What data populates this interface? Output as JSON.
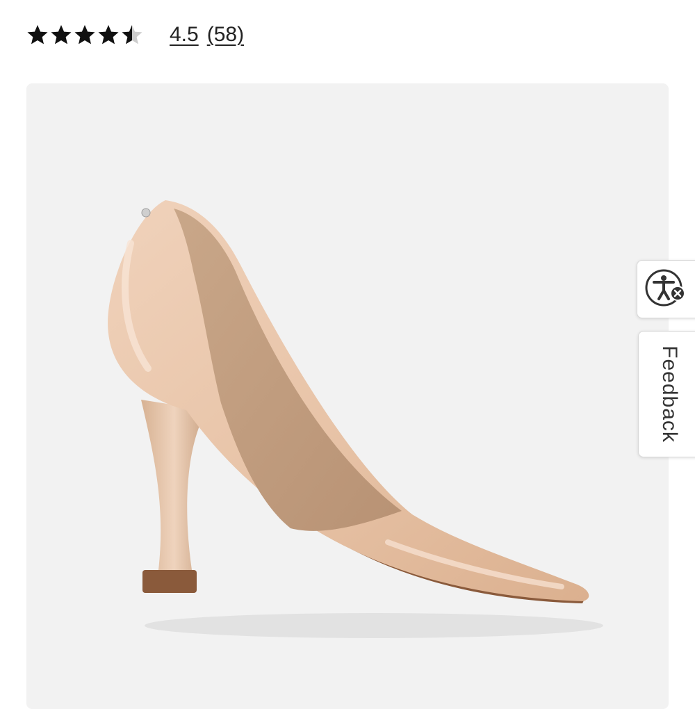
{
  "rating": {
    "value": 4.5,
    "value_label": "4.5",
    "count_label": "(58)",
    "max_stars": 5,
    "star_color": "#111111",
    "empty_star_color": "#cccccc"
  },
  "product_image": {
    "subject": "nude patent leather pointed-toe high-heel pump",
    "background_color": "#f2f2f2",
    "shoe_color": "#e8c4a8"
  },
  "side_tabs": {
    "accessibility_icon": "accessibility-icon",
    "feedback_label": "Feedback"
  }
}
